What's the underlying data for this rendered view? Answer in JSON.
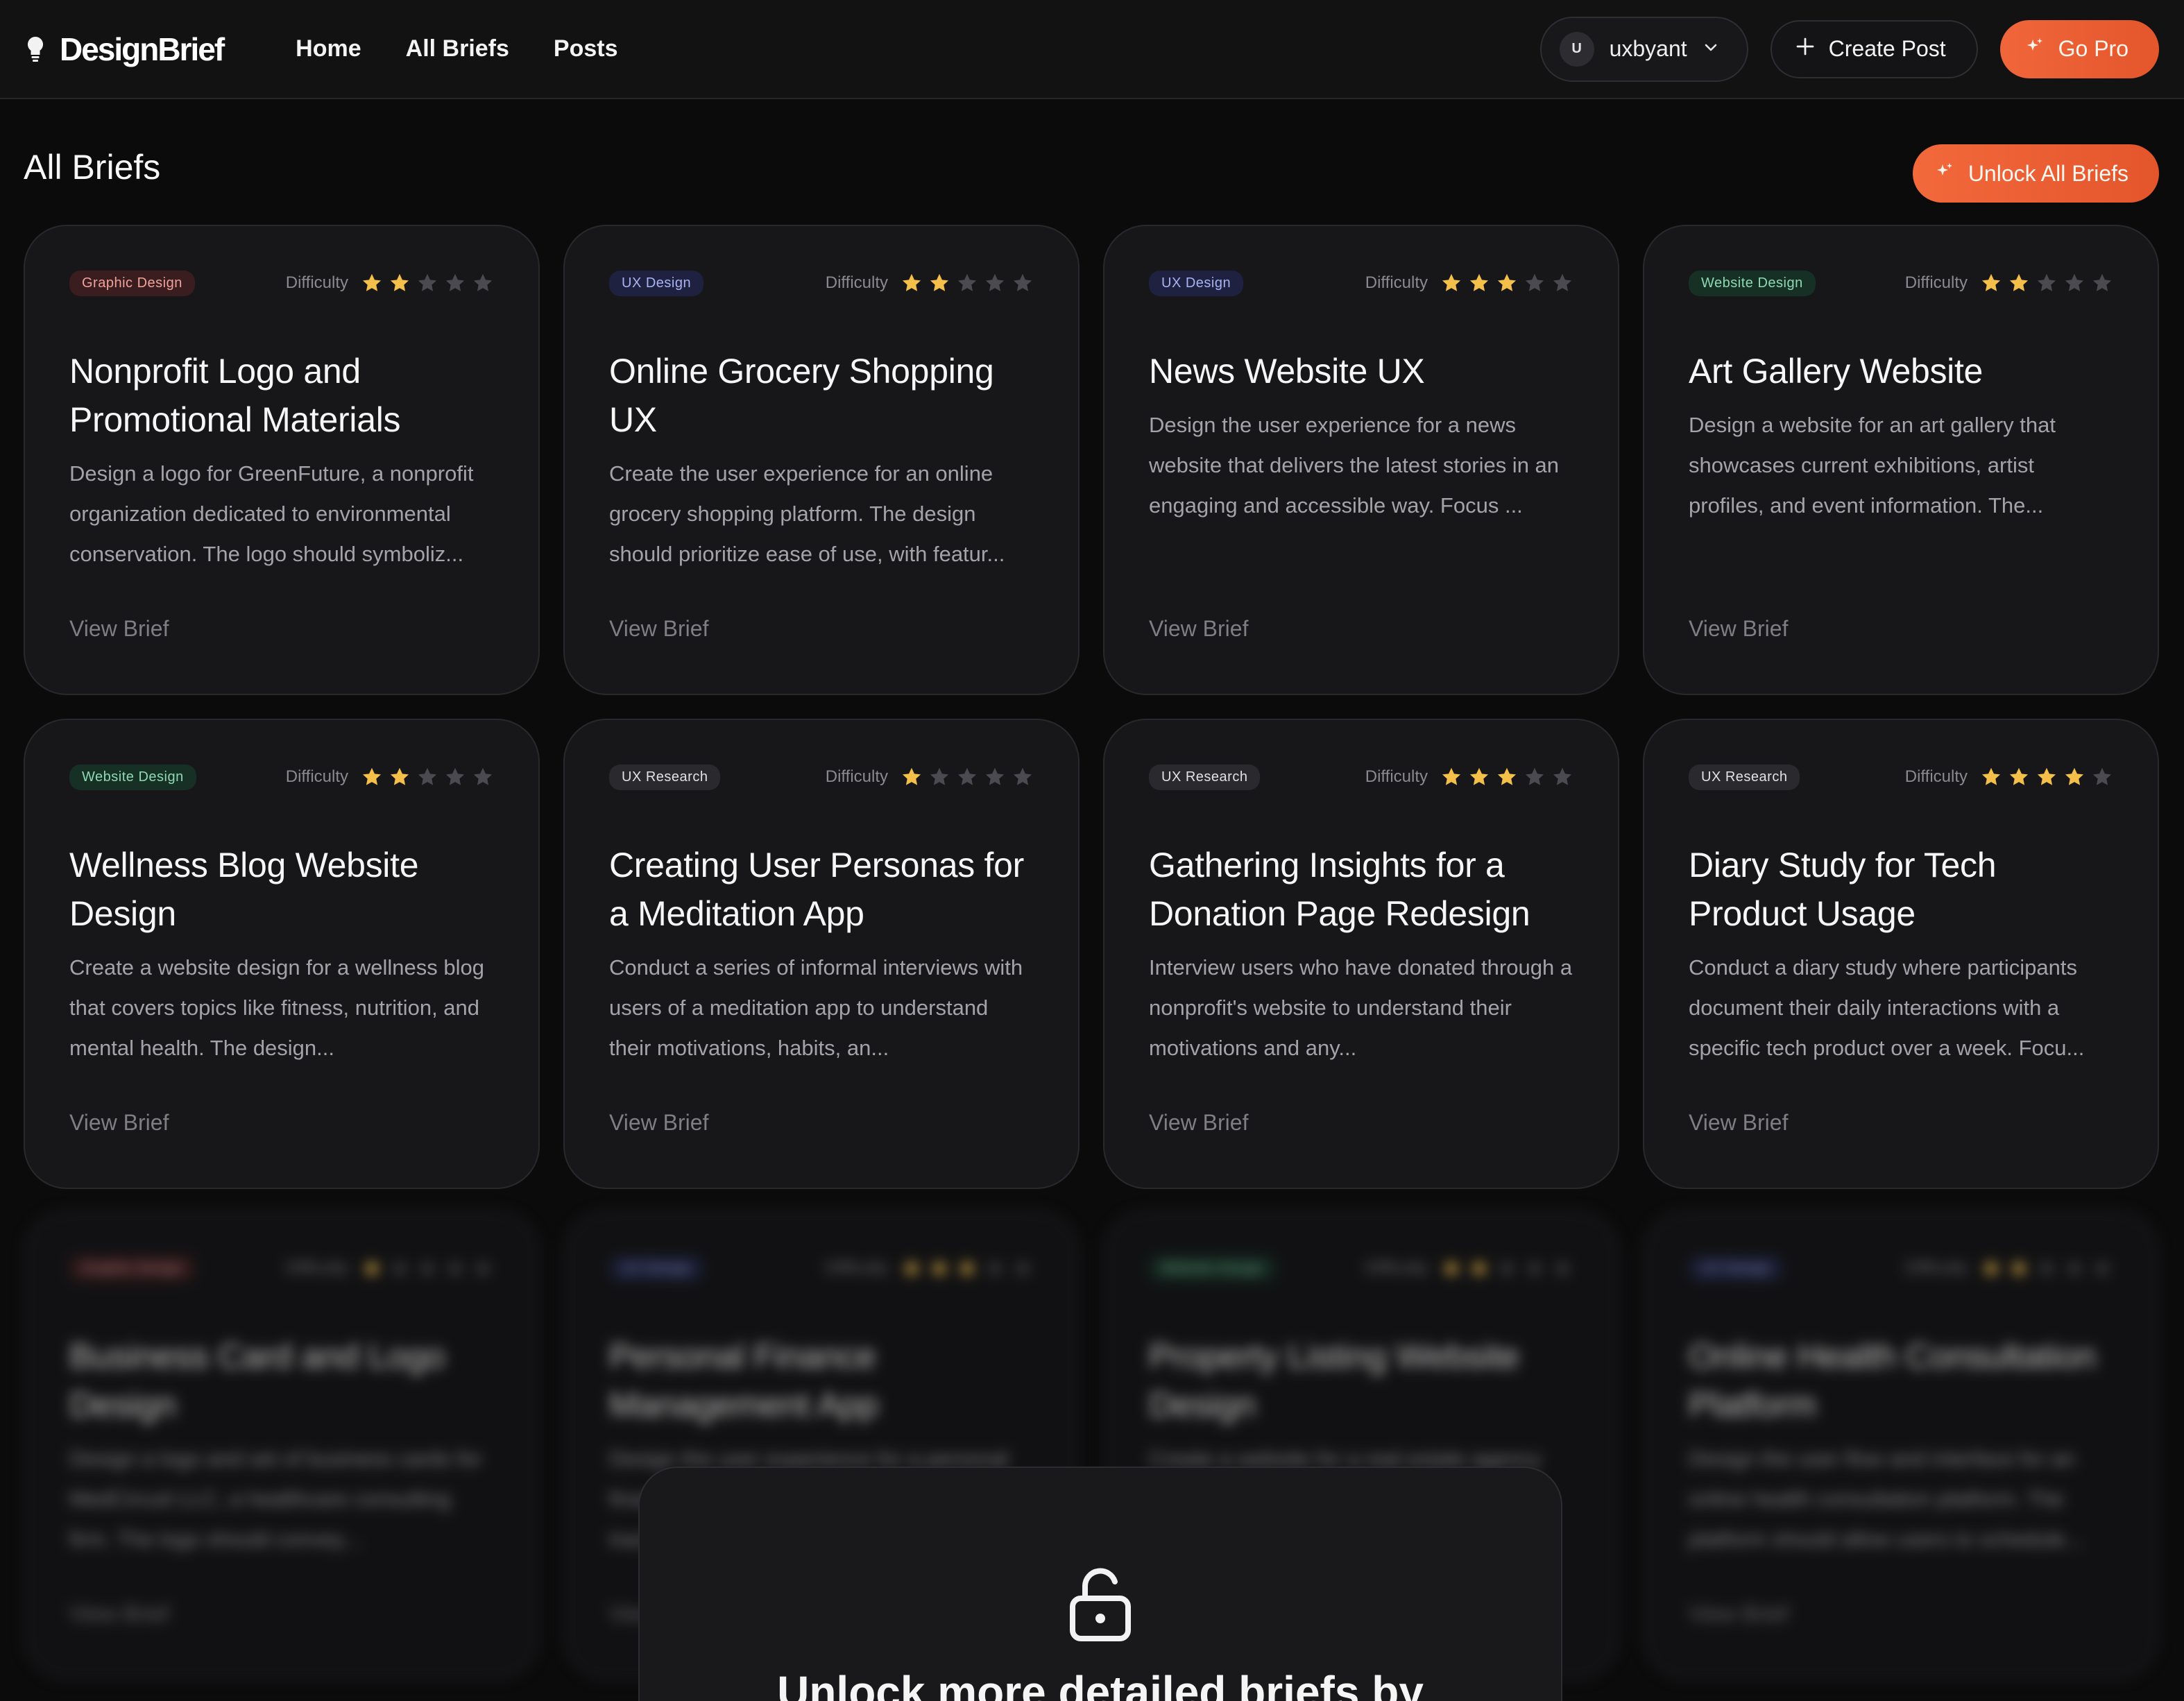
{
  "brand": {
    "name": "DesignBrief"
  },
  "nav": {
    "links": [
      "Home",
      "All Briefs",
      "Posts"
    ]
  },
  "user": {
    "initial": "U",
    "name": "uxbyant"
  },
  "actions": {
    "create_post": "Create Post",
    "go_pro": "Go Pro"
  },
  "page": {
    "title": "All Briefs",
    "unlock_all": "Unlock All Briefs"
  },
  "difficulty_label": "Difficulty",
  "view_brief_label": "View Brief",
  "colors": {
    "accent": "#ec5f33",
    "star_on": "#f4c04a",
    "star_off": "#4a4a50"
  },
  "briefs": [
    {
      "category": "Graphic Design",
      "difficulty": 2,
      "title": "Nonprofit Logo and Promotional Materials",
      "description": "Design a logo for GreenFuture, a nonprofit organization dedicated to environmental conservation. The logo should symboliz..."
    },
    {
      "category": "UX Design",
      "difficulty": 2,
      "title": "Online Grocery Shopping UX",
      "description": "Create the user experience for an online grocery shopping platform. The design should prioritize ease of use, with featur..."
    },
    {
      "category": "UX Design",
      "difficulty": 3,
      "title": "News Website UX",
      "description": "Design the user experience for a news website that delivers the latest stories in an engaging and accessible way. Focus ..."
    },
    {
      "category": "Website Design",
      "difficulty": 2,
      "title": "Art Gallery Website",
      "description": "Design a website for an art gallery that showcases current exhibitions, artist profiles, and event information. The..."
    },
    {
      "category": "Website Design",
      "difficulty": 2,
      "title": "Wellness Blog Website Design",
      "description": "Create a website design for a wellness blog that covers topics like fitness, nutrition, and mental health. The design..."
    },
    {
      "category": "UX Research",
      "difficulty": 1,
      "title": "Creating User Personas for a Meditation App",
      "description": "Conduct a series of informal interviews with users of a meditation app to understand their motivations, habits, an..."
    },
    {
      "category": "UX Research",
      "difficulty": 3,
      "title": "Gathering Insights for a Donation Page Redesign",
      "description": "Interview users who have donated through a nonprofit's website to understand their motivations and any..."
    },
    {
      "category": "UX Research",
      "difficulty": 4,
      "title": "Diary Study for Tech Product Usage",
      "description": "Conduct a diary study where participants document their daily interactions with a specific tech product over a week. Focu..."
    }
  ],
  "locked_briefs": [
    {
      "category": "Graphic Design",
      "difficulty": 1,
      "title": "Business Card and Logo Design",
      "description": "Design a logo and set of business cards for MedCircuit LLC, a healthcare consulting firm. The logo should convey..."
    },
    {
      "category": "UX Design",
      "difficulty": 3,
      "title": "Personal Finance Management App",
      "description": "Design the user experience for a personal finance management app that helps users track..."
    },
    {
      "category": "Website Design",
      "difficulty": 2,
      "title": "Property Listing Website Design",
      "description": "Create a website for a real estate agency that lists properties for sale and rent..."
    },
    {
      "category": "UX Design",
      "difficulty": 2,
      "title": "Online Health Consultation Platform",
      "description": "Design the user flow and interface for an online health consultation platform. The platform should allow users to schedule..."
    }
  ],
  "unlock_panel": {
    "text": "Unlock more detailed briefs by"
  }
}
